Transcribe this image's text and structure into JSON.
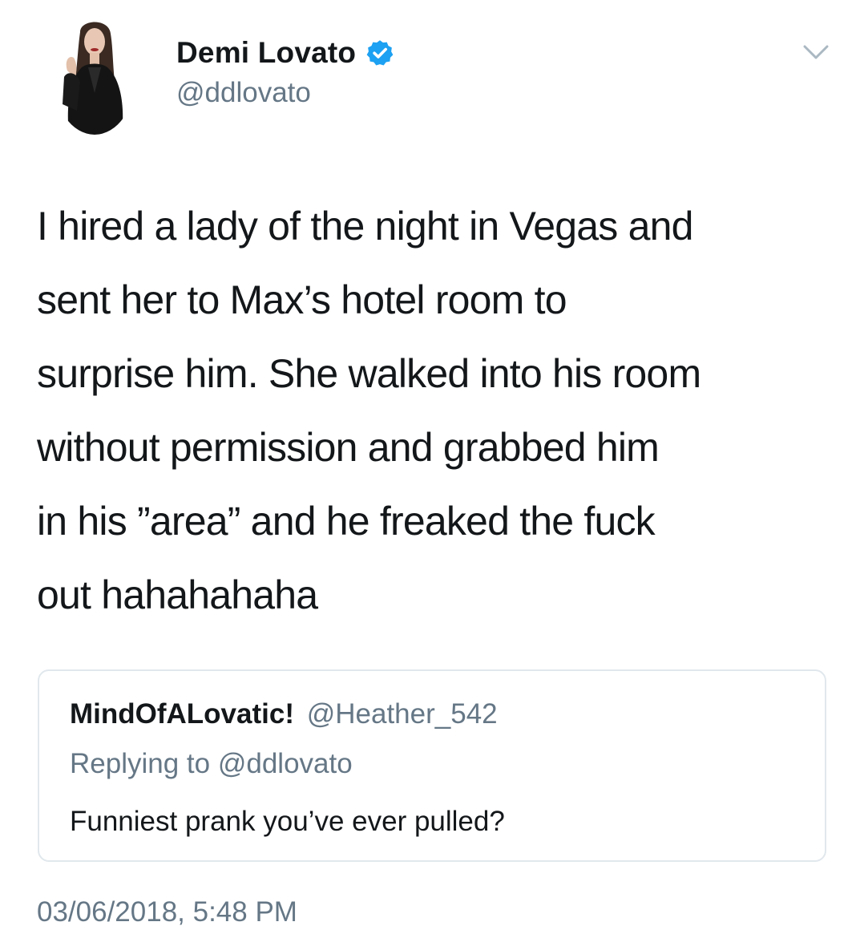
{
  "author": {
    "name": "Demi Lovato",
    "handle": "@ddlovato",
    "verified": true
  },
  "tweet": {
    "text": "I hired a lady of the night in Vegas and\nsent her to Max’s hotel room to\nsurprise him. She walked into his room\nwithout permission and grabbed him\nin his ”area” and he freaked the fuck\nout hahahahaha"
  },
  "quoted_tweet": {
    "name": "MindOfALovatic!",
    "handle": "@Heather_542",
    "replying_to": "Replying to @ddlovato",
    "text": "Funniest prank you’ve ever pulled?"
  },
  "timestamp": "03/06/2018, 5:48 PM",
  "icons": {
    "verified": "verified-badge-icon",
    "menu": "chevron-down-icon"
  },
  "colors": {
    "verified_blue": "#1da1f2",
    "text_primary": "#14171a",
    "text_secondary": "#657786",
    "border": "#e1e8ed"
  }
}
